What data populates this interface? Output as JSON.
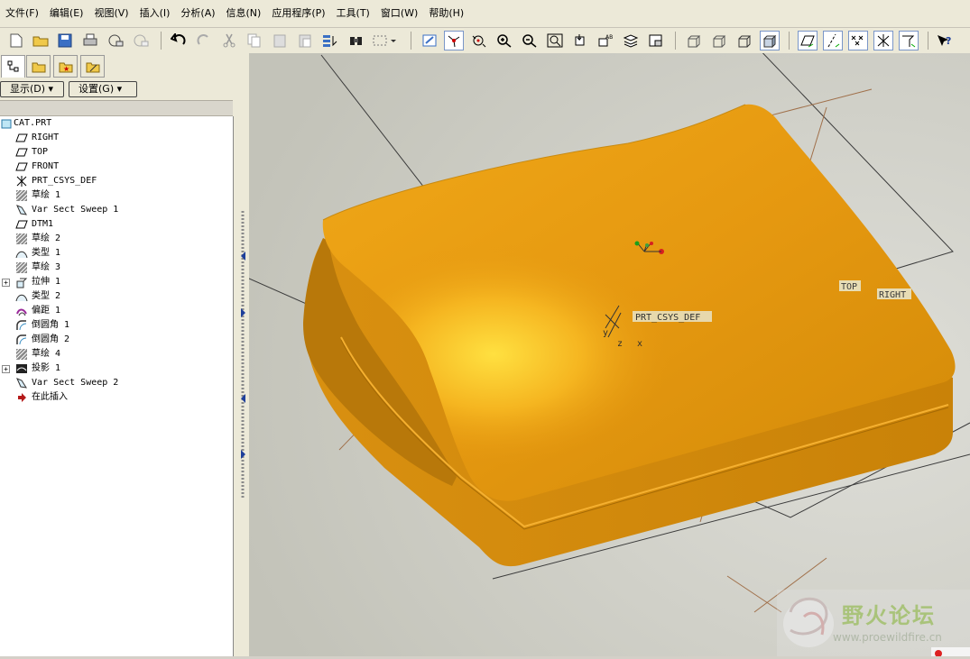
{
  "menu": [
    "文件(F)",
    "编辑(E)",
    "视图(V)",
    "插入(I)",
    "分析(A)",
    "信息(N)",
    "应用程序(P)",
    "工具(T)",
    "窗口(W)",
    "帮助(H)"
  ],
  "panel": {
    "show_label": "显示(D) ▾",
    "settings_label": "设置(G) ▾"
  },
  "tree": {
    "root": "CAT.PRT",
    "items": [
      {
        "label": "RIGHT",
        "icon": "datum-plane-icon"
      },
      {
        "label": "TOP",
        "icon": "datum-plane-icon"
      },
      {
        "label": "FRONT",
        "icon": "datum-plane-icon"
      },
      {
        "label": "PRT_CSYS_DEF",
        "icon": "csys-icon"
      },
      {
        "label": "草绘 1",
        "icon": "sketch-icon"
      },
      {
        "label": "Var Sect Sweep 1",
        "icon": "sweep-icon"
      },
      {
        "label": "DTM1",
        "icon": "datum-plane-icon"
      },
      {
        "label": "草绘 2",
        "icon": "sketch-icon"
      },
      {
        "label": "类型 1",
        "icon": "surface-icon"
      },
      {
        "label": "草绘 3",
        "icon": "sketch-icon"
      },
      {
        "label": "拉伸 1",
        "icon": "extrude-icon"
      },
      {
        "label": "类型 2",
        "icon": "surface-icon"
      },
      {
        "label": "偏距 1",
        "icon": "offset-icon"
      },
      {
        "label": "倒圆角 1",
        "icon": "round-icon"
      },
      {
        "label": "倒圆角 2",
        "icon": "round-icon"
      },
      {
        "label": "草绘 4",
        "icon": "sketch-icon"
      },
      {
        "label": "投影 1",
        "icon": "project-icon"
      },
      {
        "label": "Var Sect Sweep 2",
        "icon": "sweep-icon"
      },
      {
        "label": "在此插入",
        "icon": "insert-arrow-icon"
      }
    ]
  },
  "viewport": {
    "csys_label": "PRT_CSYS_DEF",
    "plane_top": "TOP",
    "plane_right": "RIGHT",
    "axis_y": "y",
    "axis_z": "z",
    "axis_x": "x",
    "model_color": "#e69a10",
    "background_color": "#d2d2ca"
  },
  "watermark": {
    "title": "野火论坛",
    "url": "www.proewildfire.cn"
  }
}
